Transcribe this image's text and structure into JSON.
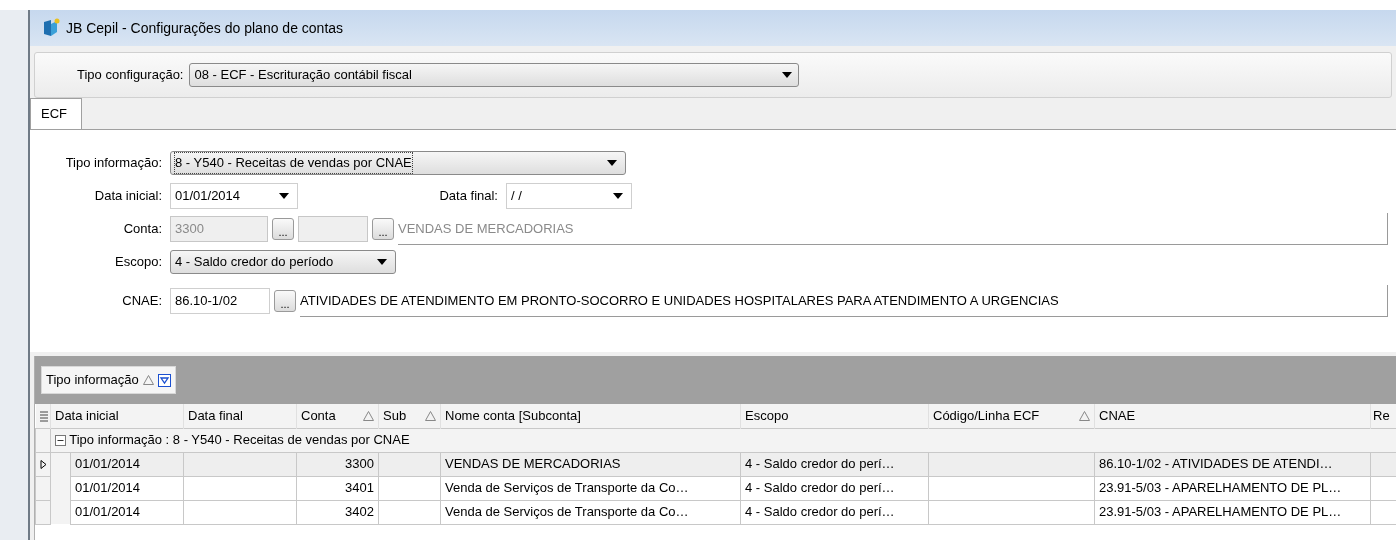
{
  "window": {
    "title": "JB Cepil - Configurações do plano de contas"
  },
  "config": {
    "label": "Tipo configuração:",
    "value": "08 - ECF - Escrituração contábil fiscal"
  },
  "tabs": [
    {
      "label": "ECF",
      "selected": true
    }
  ],
  "form": {
    "tipo_informacao": {
      "label": "Tipo informação:",
      "value": "8 - Y540 - Receitas de vendas por CNAE"
    },
    "data_inicial": {
      "label": "Data inicial:",
      "value": "01/01/2014"
    },
    "data_final": {
      "label": "Data final:",
      "value": "/ /"
    },
    "conta": {
      "label": "Conta:",
      "value": "3300",
      "browse_label": "...",
      "sub_browse_label": "...",
      "description": "VENDAS DE MERCADORIAS",
      "disabled": true
    },
    "escopo": {
      "label": "Escopo:",
      "value": "4 - Saldo credor do período"
    },
    "cnae": {
      "label": "CNAE:",
      "value": "86.10-1/02",
      "browse_label": "...",
      "description": "ATIVIDADES DE ATENDIMENTO EM PRONTO-SOCORRO E UNIDADES HOSPITALARES PARA ATENDIMENTO A URGENCIAS"
    }
  },
  "grid": {
    "group_panel": {
      "label": "Tipo informação",
      "sorted": true
    },
    "columns": [
      {
        "label": "Data inicial",
        "sorted": false
      },
      {
        "label": "Data final",
        "sorted": false
      },
      {
        "label": "Conta",
        "sorted": true
      },
      {
        "label": "Sub",
        "sorted": true
      },
      {
        "label": "Nome conta [Subconta]",
        "sorted": false
      },
      {
        "label": "Escopo",
        "sorted": false
      },
      {
        "label": "Código/Linha ECF",
        "sorted": true
      },
      {
        "label": "CNAE",
        "sorted": false
      },
      {
        "label": "Re"
      }
    ],
    "group_row": {
      "text": "Tipo informação : 8 - Y540 - Receitas de vendas por CNAE",
      "expanded": true
    },
    "rows": [
      {
        "selected": true,
        "cells": [
          "01/01/2014",
          null,
          "3300",
          null,
          "VENDAS DE MERCADORIAS",
          "4 - Saldo credor do perí…",
          null,
          "86.10-1/02 - ATIVIDADES DE ATENDI…",
          null
        ]
      },
      {
        "selected": false,
        "cells": [
          "01/01/2014",
          null,
          "3401",
          null,
          "Venda de Serviços de Transporte da Co…",
          "4 - Saldo credor do perí…",
          null,
          "23.91-5/03 - APARELHAMENTO DE PL…",
          null
        ]
      },
      {
        "selected": false,
        "cells": [
          "01/01/2014",
          null,
          "3402",
          null,
          "Venda de Serviços de Transporte da Co…",
          "4 - Saldo credor do perí…",
          null,
          "23.91-5/03 - APARELHAMENTO DE PL…",
          null
        ]
      }
    ]
  }
}
